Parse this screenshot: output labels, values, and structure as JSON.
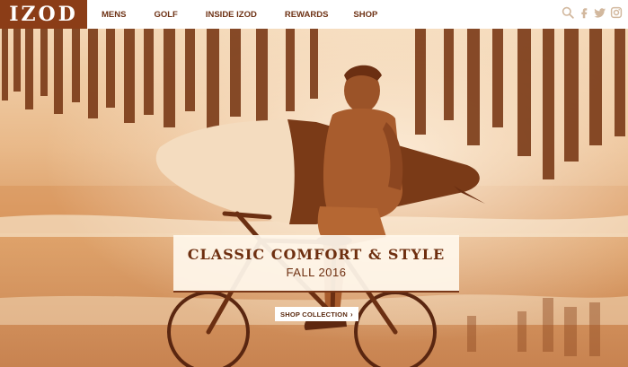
{
  "brand": {
    "logo_text": "IZOD",
    "logo_color": "#8b3d17"
  },
  "nav": {
    "items": [
      {
        "label": "MENS"
      },
      {
        "label": "GOLF"
      },
      {
        "label": "INSIDE IZOD"
      },
      {
        "label": "REWARDS"
      },
      {
        "label": "SHOP"
      }
    ]
  },
  "header_icons": [
    "search-icon",
    "facebook-icon",
    "twitter-icon",
    "instagram-icon"
  ],
  "hero": {
    "tint_color": "#b8642a",
    "headline": "CLASSIC COMFORT & STYLE",
    "subheadline": "FALL 2016",
    "cta_label": "SHOP COLLECTION",
    "cta_icon": "chevron-right-icon"
  }
}
